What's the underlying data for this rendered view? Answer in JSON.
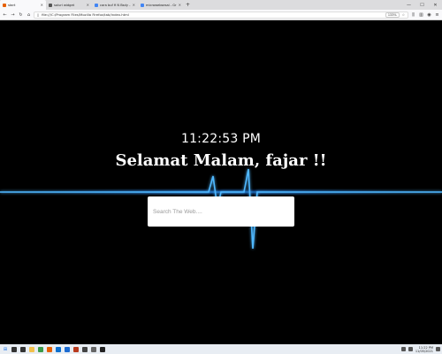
{
  "browser": {
    "tabs": [
      {
        "label": "start",
        "active": true,
        "color": "#e66000"
      },
      {
        "label": "soluri widget",
        "active": false,
        "color": "#555555"
      },
      {
        "label": "cara buf fi N Bsdy - Google Sea...",
        "active": false,
        "color": "#4285f4"
      },
      {
        "label": "microwebsesai - Gr - Google Sea...",
        "active": false,
        "color": "#4285f4"
      }
    ],
    "new_tab_symbol": "+",
    "url": "file:///C:/Program Files/Mozilla Firefox/tab/index.html",
    "zoom": "133%",
    "window_controls": {
      "minimize": "—",
      "maximize": "☐",
      "close": "✕"
    }
  },
  "page": {
    "time": "11:22:53 PM",
    "greeting": "Selamat Malam, fajar !!",
    "search_placeholder": "Search The Web....",
    "glow_color": "#1e90ff"
  },
  "taskbar": {
    "start_icon": "windows-icon",
    "apps": [
      {
        "name": "search-icon",
        "color": "#333333"
      },
      {
        "name": "task-view-icon",
        "color": "#333333"
      },
      {
        "name": "folder-icon",
        "color": "#f2c04b"
      },
      {
        "name": "chrome-icon",
        "color": "#3a9a48"
      },
      {
        "name": "firefox-icon",
        "color": "#e66000"
      },
      {
        "name": "store-icon",
        "color": "#0b6fcf"
      },
      {
        "name": "mail-icon",
        "color": "#1c6bd1"
      },
      {
        "name": "photos-icon",
        "color": "#b83a1e"
      },
      {
        "name": "media-icon",
        "color": "#444444"
      },
      {
        "name": "settings-icon",
        "color": "#666666"
      },
      {
        "name": "terminal-icon",
        "color": "#222222"
      }
    ],
    "time": "11:22 PM",
    "date": "11/05/2021"
  }
}
